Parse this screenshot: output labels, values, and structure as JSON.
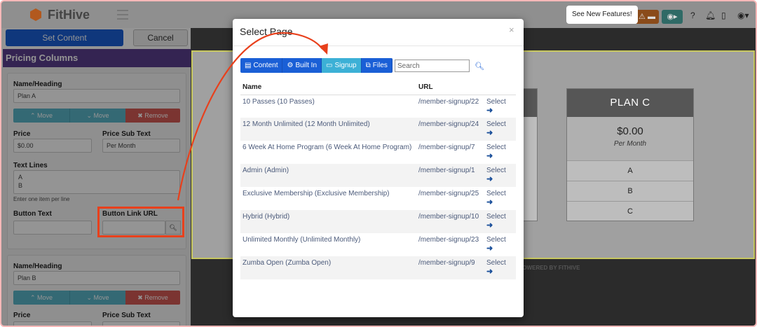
{
  "app": {
    "brand": "FitHive",
    "new_features": "See New Features!",
    "warn_icon": "⚠",
    "card_icon": "▬",
    "rec_icon": "◉▸"
  },
  "editor": {
    "set_content": "Set Content",
    "cancel": "Cancel",
    "section_title": "Pricing Columns",
    "columns": [
      {
        "name_label": "Name/Heading",
        "name_value": "Plan A",
        "move_up": "⌃ Move",
        "move_down": "⌄ Move",
        "remove": "✖ Remove",
        "price_label": "Price",
        "price_value": "$0.00",
        "subtext_label": "Price Sub Text",
        "subtext_value": "Per Month",
        "lines_label": "Text Lines",
        "lines_value": "A\nB",
        "lines_hint": "Enter one item per line",
        "button_text_label": "Button Text",
        "button_text_value": "",
        "button_url_label": "Button Link URL",
        "button_url_value": ""
      },
      {
        "name_label": "Name/Heading",
        "name_value": "Plan B",
        "move_up": "⌃ Move",
        "move_down": "⌄ Move",
        "remove": "✖ Remove",
        "price_label": "Price",
        "subtext_label": "Price Sub Text"
      }
    ]
  },
  "preview": {
    "plan_c": {
      "title": "PLAN C",
      "price": "$0.00",
      "per": "Per Month",
      "lines": [
        "A",
        "B",
        "C"
      ]
    },
    "powered": "POWERED BY  FITHIVE"
  },
  "modal": {
    "title": "Select Page",
    "close": "×",
    "tabs": [
      {
        "label": "Content",
        "icon": "▤",
        "active": false
      },
      {
        "label": "Built In",
        "icon": "⚙",
        "active": false
      },
      {
        "label": "Signup",
        "icon": "▭",
        "active": true
      },
      {
        "label": "Files",
        "icon": "⧉",
        "active": false
      }
    ],
    "search_placeholder": "Search",
    "columns": [
      "Name",
      "URL",
      ""
    ],
    "rows": [
      {
        "name": "10 Passes (10 Passes)",
        "url": "/member-signup/22",
        "action": "Select"
      },
      {
        "name": "12 Month Unlimited (12 Month Unlimited)",
        "url": "/member-signup/24",
        "action": "Select"
      },
      {
        "name": "6 Week At Home Program (6 Week At Home Program)",
        "url": "/member-signup/7",
        "action": "Select"
      },
      {
        "name": "Admin (Admin)",
        "url": "/member-signup/1",
        "action": "Select"
      },
      {
        "name": "Exclusive Membership (Exclusive Membership)",
        "url": "/member-signup/25",
        "action": "Select"
      },
      {
        "name": "Hybrid (Hybrid)",
        "url": "/member-signup/10",
        "action": "Select"
      },
      {
        "name": "Unlimited Monthly (Unlimited Monthly)",
        "url": "/member-signup/23",
        "action": "Select"
      },
      {
        "name": "Zumba Open (Zumba Open)",
        "url": "/member-signup/9",
        "action": "Select"
      }
    ]
  },
  "colors": {
    "primary": "#1a5fd6",
    "active_tab": "#3cb0d6",
    "annotation": "#e8401c",
    "section_header": "#5b3f8e"
  }
}
